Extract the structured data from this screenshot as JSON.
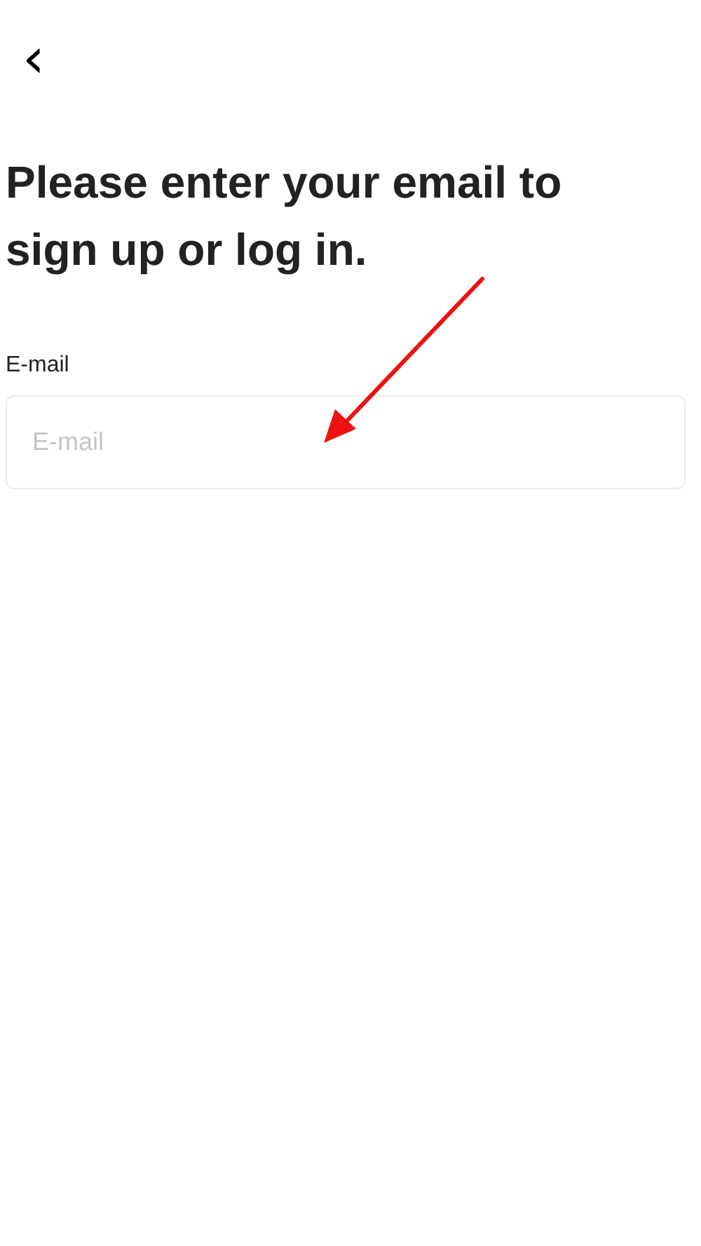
{
  "back_button": {
    "icon": "‹"
  },
  "heading": "Please enter your email to sign up or log in.",
  "email_field": {
    "label": "E-mail",
    "placeholder": "E-mail"
  }
}
